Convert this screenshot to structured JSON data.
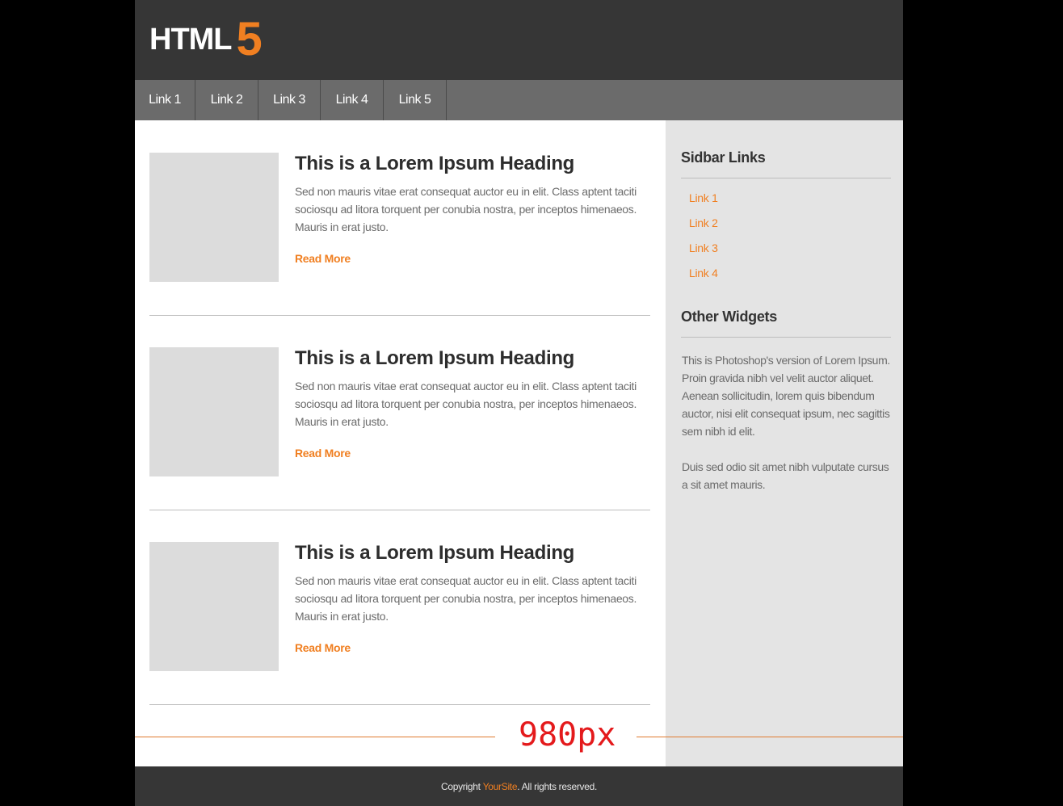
{
  "header": {
    "logo_text": "HTML",
    "logo_number": "5"
  },
  "nav": {
    "items": [
      {
        "label": "Link 1"
      },
      {
        "label": "Link 2"
      },
      {
        "label": "Link 3"
      },
      {
        "label": "Link 4"
      },
      {
        "label": "Link 5"
      }
    ]
  },
  "posts": [
    {
      "title": "This is a Lorem Ipsum  Heading",
      "body": "Sed non  mauris vitae erat consequat auctor eu in elit. Class aptent taciti sociosqu ad litora torquent per conubia nostra, per inceptos himenaeos. Mauris in erat justo.",
      "read_more": "Read More"
    },
    {
      "title": "This is a Lorem Ipsum  Heading",
      "body": "Sed non  mauris vitae erat consequat auctor eu in elit. Class aptent taciti sociosqu ad litora torquent per conubia nostra, per inceptos himenaeos. Mauris in erat justo.",
      "read_more": "Read More"
    },
    {
      "title": "This is a Lorem Ipsum  Heading",
      "body": "Sed non  mauris vitae erat consequat auctor eu in elit. Class aptent taciti sociosqu ad litora torquent per conubia nostra, per inceptos himenaeos. Mauris in erat justo.",
      "read_more": "Read More"
    }
  ],
  "sidebar": {
    "links_heading": "Sidbar Links",
    "links": [
      {
        "label": "Link 1"
      },
      {
        "label": "Link 2"
      },
      {
        "label": "Link 3"
      },
      {
        "label": "Link 4"
      }
    ],
    "widgets_heading": "Other Widgets",
    "widget_paragraphs": [
      "This is Photoshop's version  of Lorem Ipsum. Proin gravida nibh vel velit auctor aliquet. Aenean sollicitudin, lorem quis bibendum auctor, nisi elit consequat ipsum, nec sagittis sem nibh id elit.",
      "Duis sed odio sit amet nibh vulputate cursus a sit amet mauris."
    ]
  },
  "annotation": {
    "width_label": "980px"
  },
  "footer": {
    "prefix": "Copyright ",
    "brand": "YourSite",
    "suffix": ". All rights reserved."
  },
  "colors": {
    "accent": "#f07f21",
    "header_bg": "#363636",
    "nav_bg": "#6b6b6b",
    "sidebar_bg": "#e4e4e4",
    "annotation_label": "#e41a1c"
  }
}
